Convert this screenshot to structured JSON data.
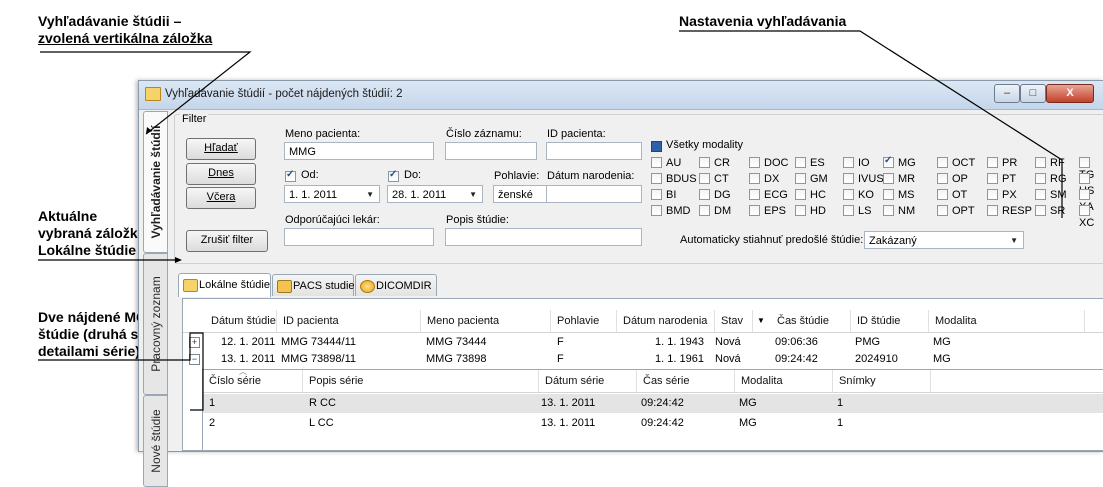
{
  "callouts": {
    "c1_line1": "Vyhľadávanie štúdii –",
    "c1_line2": "zvolená vertikálna záložka",
    "c2": "Nastavenia vyhľadávania",
    "c3_line1": "Aktuálne",
    "c3_line2": "vybraná záložka",
    "c3_line3": "Lokálne štúdie",
    "c4_line1": "Dve nájdené MG",
    "c4_line2": "štúdie (druhá s",
    "c4_line3": "detailami série)"
  },
  "window": {
    "title": "Vyhľadávanie štúdií - počet nájdených štúdií: 2",
    "minimize": "–",
    "maximize": "□",
    "close": "X"
  },
  "vtabs": [
    {
      "label": "Vyhľadávanie štúdií",
      "active": true
    },
    {
      "label": "Pracovný zoznam",
      "active": false
    },
    {
      "label": "Nové štúdie",
      "active": false
    }
  ],
  "filter": {
    "group_title": "Filter",
    "buttons": {
      "search": "Hľadať",
      "today": "Dnes",
      "yesterday": "Včera",
      "cancel": "Zrušiť filter"
    },
    "patient_name_label": "Meno pacienta:",
    "patient_name_value": "MMG",
    "record_no_label": "Číslo záznamu:",
    "record_no_value": "",
    "patient_id_label": "ID pacienta:",
    "patient_id_value": "",
    "from_label": "Od:",
    "from_value": "1.  1. 2011",
    "to_label": "Do:",
    "to_value": "28.  1. 2011",
    "gender_label": "Pohlavie:",
    "gender_value": "ženské",
    "birthdate_label": "Dátum narodenia:",
    "birthdate_value": "",
    "referring_label": "Odporúčajúci lekár:",
    "referring_value": "",
    "description_label": "Popis štúdie:",
    "description_value": "",
    "all_modalities_label": "Všetky modality",
    "modalities": [
      [
        "AU",
        "CR",
        "DOC",
        "ES",
        "IO",
        "MG",
        "OCT",
        "PR",
        "RF",
        "TG"
      ],
      [
        "BDUS",
        "CT",
        "DX",
        "GM",
        "IVUS",
        "MR",
        "OP",
        "PT",
        "RG",
        "US"
      ],
      [
        "BI",
        "DG",
        "ECG",
        "HC",
        "KO",
        "MS",
        "OT",
        "PX",
        "SM",
        "XA"
      ],
      [
        "BMD",
        "DM",
        "EPS",
        "HD",
        "LS",
        "NM",
        "OPT",
        "RESP",
        "SR",
        "XC"
      ]
    ],
    "checked_modality": "MG",
    "auto_download_label": "Automaticky stiahnuť predošlé štúdie:",
    "auto_download_value": "Zakázaný"
  },
  "tabs": [
    {
      "label": "Lokálne štúdie",
      "active": true
    },
    {
      "label": "PACS studie",
      "active": false
    },
    {
      "label": "DICOMDIR",
      "active": false
    }
  ],
  "studies": {
    "columns": [
      "Dátum štúdie",
      "ID pacienta",
      "Meno pacienta",
      "Pohlavie",
      "Dátum narodenia",
      "Stav",
      "Čas štúdie",
      "ID štúdie",
      "Modalita"
    ],
    "rows": [
      {
        "expander": "+",
        "date": "12. 1. 2011",
        "pid": "MMG 73444/11",
        "name": "MMG 73444",
        "sex": "F",
        "birth": "1. 1. 1943",
        "status": "Nová",
        "time": "09:06:36",
        "sid": "PMG",
        "mod": "MG"
      },
      {
        "expander": "−",
        "date": "13. 1. 2011",
        "pid": "MMG 73898/11",
        "name": "MMG 73898",
        "sex": "F",
        "birth": "1. 1. 1961",
        "status": "Nová",
        "time": "09:24:42",
        "sid": "2024910",
        "mod": "MG"
      }
    ]
  },
  "series": {
    "columns": [
      "Číslo série",
      "Popis série",
      "Dátum série",
      "Čas série",
      "Modalita",
      "Snímky"
    ],
    "rows": [
      {
        "no": "1",
        "desc": "R CC",
        "date": "13. 1. 2011",
        "time": "09:24:42",
        "mod": "MG",
        "images": "1"
      },
      {
        "no": "2",
        "desc": "L CC",
        "date": "13. 1. 2011",
        "time": "09:24:42",
        "mod": "MG",
        "images": "1"
      }
    ]
  }
}
